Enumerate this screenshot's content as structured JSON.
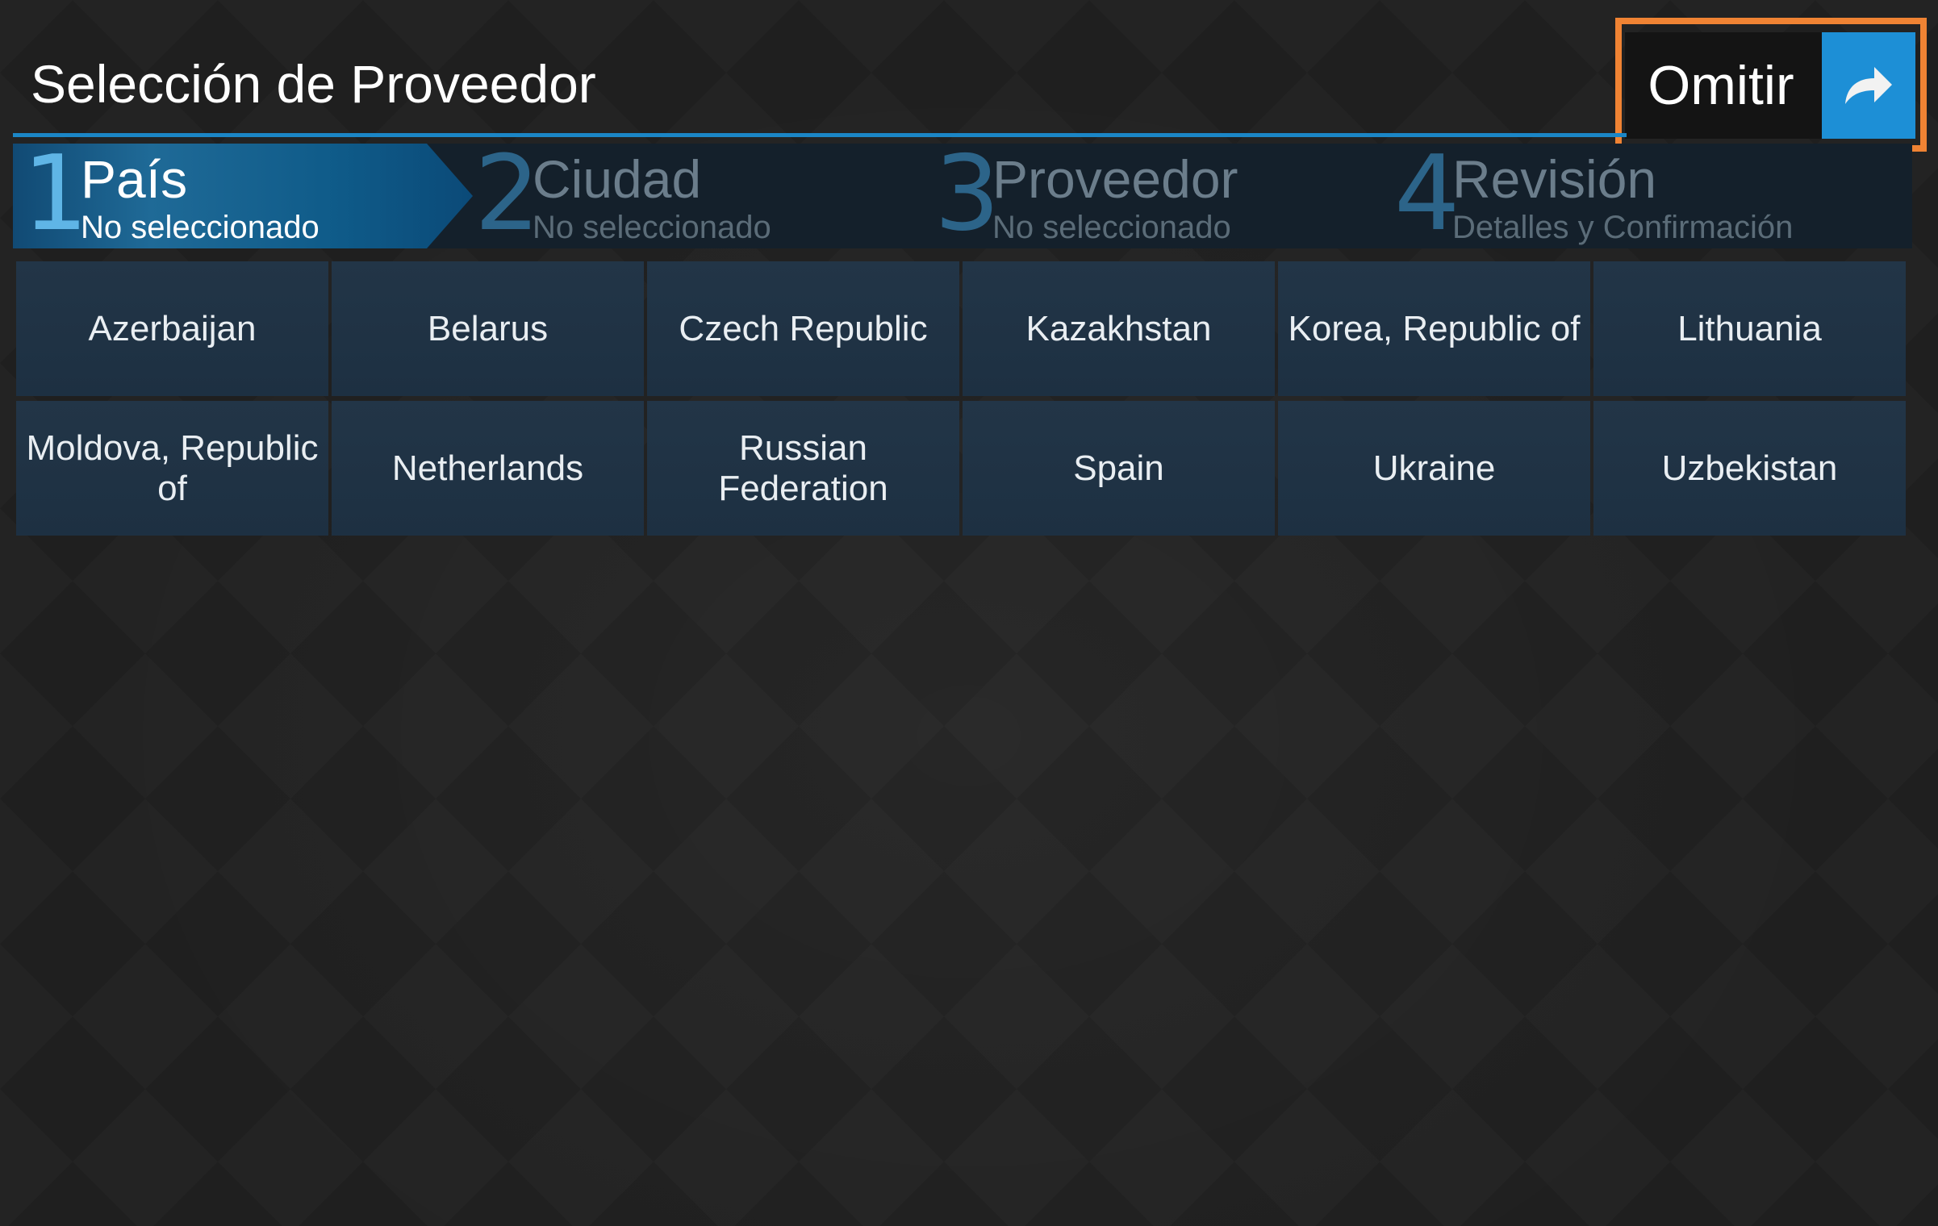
{
  "header": {
    "title": "Selección de Proveedor",
    "skip_label": "Omitir",
    "skip_icon": "arrow-right-icon",
    "accent_color": "#1d8fd6",
    "highlight_color": "#f08333"
  },
  "steps": [
    {
      "number": "1",
      "title": "País",
      "subtitle": "No seleccionado",
      "active": true
    },
    {
      "number": "2",
      "title": "Ciudad",
      "subtitle": "No seleccionado",
      "active": false
    },
    {
      "number": "3",
      "title": "Proveedor",
      "subtitle": "No seleccionado",
      "active": false
    },
    {
      "number": "4",
      "title": "Revisión",
      "subtitle": "Detalles y Confirmación",
      "active": false
    }
  ],
  "countries": [
    "Azerbaijan",
    "Belarus",
    "Czech Republic",
    "Kazakhstan",
    "Korea, Republic of",
    "Lithuania",
    "Moldova, Republic of",
    "Netherlands",
    "Russian Federation",
    "Spain",
    "Ukraine",
    "Uzbekistan"
  ]
}
